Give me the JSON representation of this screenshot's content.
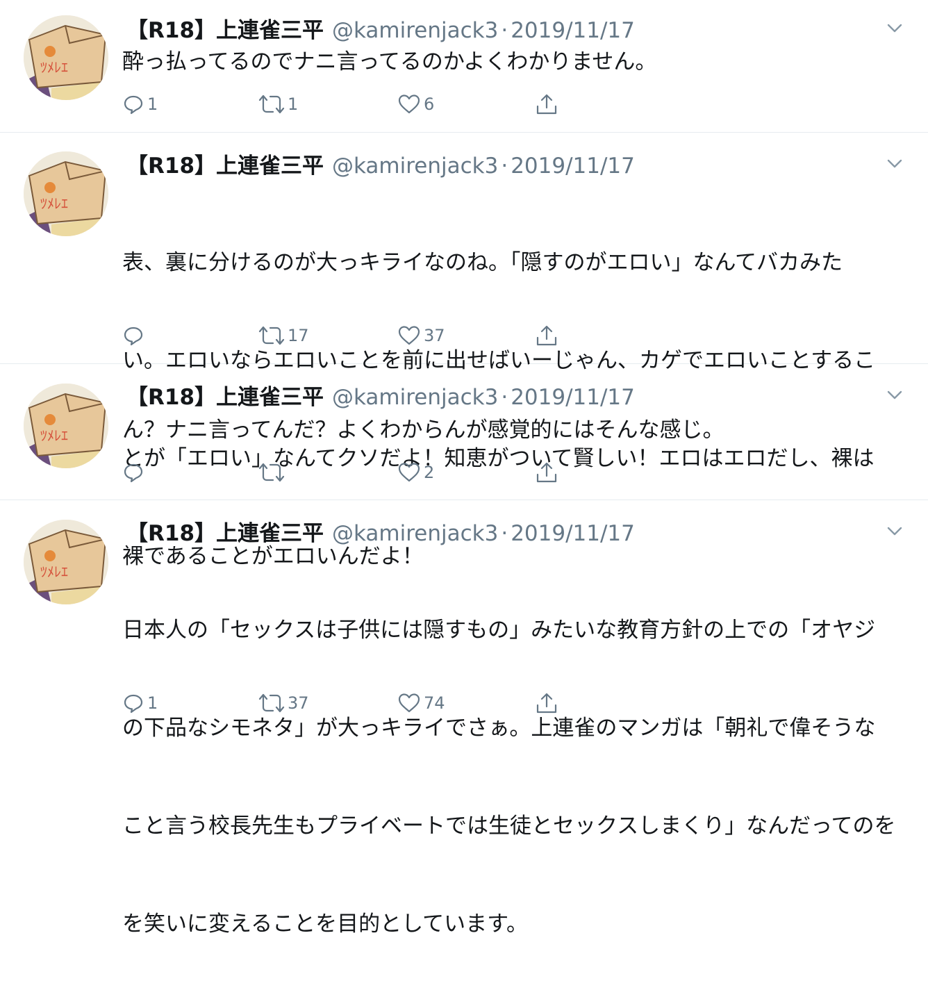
{
  "colors": {
    "text": "#14171a",
    "secondary": "#657786",
    "divider": "#e6ecf0",
    "background": "#ffffff"
  },
  "icons": {
    "reply": "reply-icon",
    "retweet": "retweet-icon",
    "like": "heart-icon",
    "share": "share-icon",
    "caret": "chevron-down-icon"
  },
  "avatar": {
    "logo_text": "ﾂﾒﾚｴ"
  },
  "tweets": [
    {
      "name": "【R18】上連雀三平",
      "handle": "@kamirenjack3",
      "separator": "·",
      "date": "2019/11/17",
      "lines": [
        "酔っ払ってるのでナニ言ってるのかよくわかりません。"
      ],
      "replies": "1",
      "retweets": "1",
      "likes": "6"
    },
    {
      "name": "【R18】上連雀三平",
      "handle": "@kamirenjack3",
      "separator": "·",
      "date": "2019/11/17",
      "lines": [
        "表、裏に分けるのが大っキライなのね。「隠すのがエロい」なんてバカみた",
        "い。エロいならエロいことを前に出せばいーじゃん、カゲでエロいことするこ",
        "とが「エロい」なんてクソだよ！知恵がついて賢しい！エロはエロだし、裸は",
        "裸であることがエロいんだよ！"
      ],
      "replies": "",
      "retweets": "17",
      "likes": "37"
    },
    {
      "name": "【R18】上連雀三平",
      "handle": "@kamirenjack3",
      "separator": "·",
      "date": "2019/11/17",
      "lines": [
        "ん？ナニ言ってんだ？よくわからんが感覚的にはそんな感じ。"
      ],
      "replies": "",
      "retweets": "",
      "likes": "2"
    },
    {
      "name": "【R18】上連雀三平",
      "handle": "@kamirenjack3",
      "separator": "·",
      "date": "2019/11/17",
      "lines": [
        "日本人の「セックスは子供には隠すもの」みたいな教育方針の上での「オヤジ",
        "の下品なシモネタ」が大っキライでさぁ。上連雀のマンガは「朝礼で偉そうな",
        "こと言う校長先生もプライベートでは生徒とセックスしまくり」なんだってのを",
        "を笑いに変えることを目的としています。"
      ],
      "replies": "1",
      "retweets": "37",
      "likes": "74"
    }
  ]
}
